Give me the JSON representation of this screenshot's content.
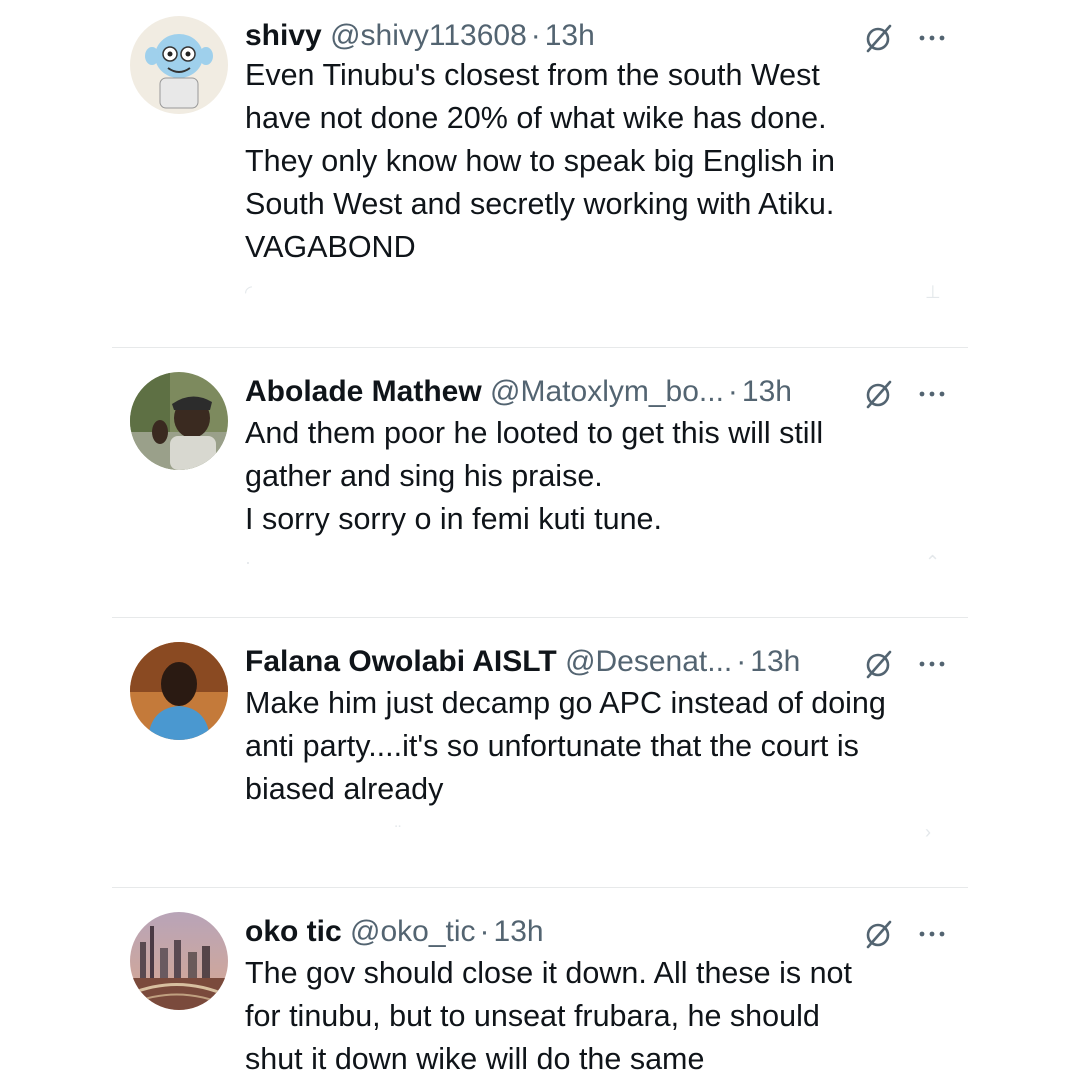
{
  "replies": [
    {
      "name": "shivy",
      "handle": "@shivy113608",
      "time": "13h",
      "text": "Even Tinubu's   closest from the south West\nhave not done 20% of what wike has done.\nThey only know how to speak big English in\nSouth West and secretly working with Atiku.\nVAGABOND",
      "avatar_icon": "cartoon-avatar",
      "avatar_color": "#9fd0ec"
    },
    {
      "name": "Abolade Mathew",
      "handle": "@Matoxlym_bo...",
      "time": "13h",
      "text": "And them poor he looted to get this will still\ngather and sing his praise.\nI sorry sorry o in femi kuti tune.",
      "avatar_icon": "photo-avatar",
      "avatar_color": "#6f7a55"
    },
    {
      "name": "Falana Owolabi AISLT",
      "handle": "@Desenat...",
      "time": "13h",
      "text": "Make him just decamp go APC instead of doing\nanti party....it's so unfortunate that the court is\nbiased already",
      "avatar_icon": "photo-avatar",
      "avatar_color": "#4a90c8"
    },
    {
      "name": "oko tic",
      "handle": "@oko_tic",
      "time": "13h",
      "text": "The gov should close it down. All these is not\nfor tinubu, but to unseat frubara, he should\nshut it down wike will do the same",
      "avatar_icon": "cityscape-avatar",
      "avatar_color": "#8b5a4a"
    }
  ],
  "icons": {
    "grok": "grok-icon",
    "more": "more-icon"
  },
  "colors": {
    "text": "#0f1419",
    "secondary": "#536471",
    "divider": "#e7e9ea"
  }
}
